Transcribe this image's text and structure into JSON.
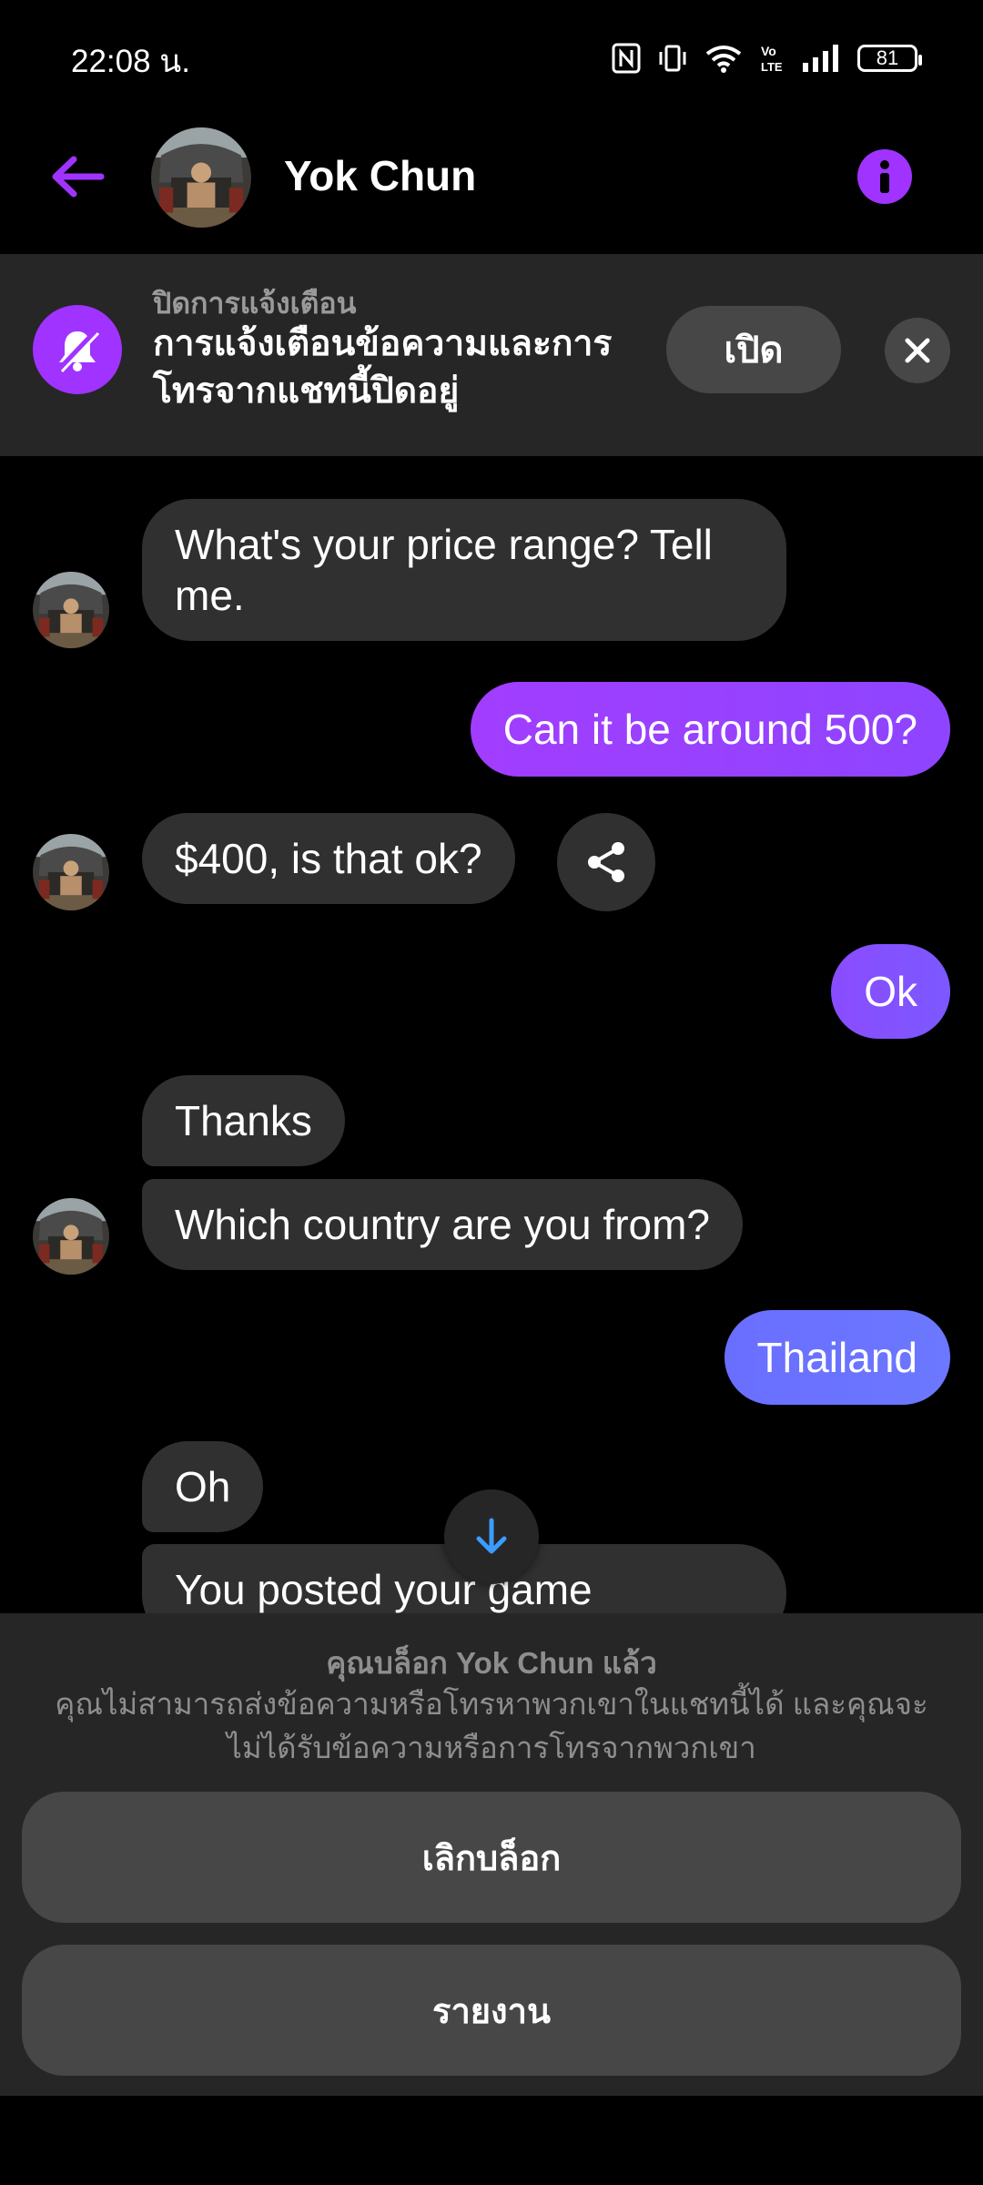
{
  "status_bar": {
    "time": "22:08 น.",
    "battery": "81",
    "icons": [
      "nfc-icon",
      "vibrate-icon",
      "wifi-icon",
      "volte-icon",
      "signal-icon",
      "battery-icon"
    ]
  },
  "header": {
    "contact_name": "Yok Chun",
    "back_icon": "arrow-left-icon",
    "info_icon": "info-icon"
  },
  "banner": {
    "title": "ปิดการแจ้งเตือน",
    "text": "การแจ้งเตือนข้อความและการโทรจากแชทนี้ปิดอยู่",
    "button_label": "เปิด",
    "icon": "bell-off-icon"
  },
  "messages": [
    {
      "from": "them",
      "text": "What's your price range? Tell me."
    },
    {
      "from": "me",
      "text": "Can it be around 500?"
    },
    {
      "from": "them",
      "text": "$400, is that ok?"
    },
    {
      "from": "me",
      "text": "Ok"
    },
    {
      "from": "them",
      "text": "Thanks"
    },
    {
      "from": "them",
      "text": "Which country are you from?"
    },
    {
      "from": "me",
      "text": "Thailand"
    },
    {
      "from": "them",
      "text": "Oh"
    },
    {
      "from": "them",
      "text": "You posted your game"
    }
  ],
  "blocked": {
    "title": "คุณบล็อก Yok Chun แล้ว",
    "description": "คุณไม่สามารถส่งข้อความหรือโทรหาพวกเขาในแชทนี้ได้ และคุณจะไม่ได้รับข้อความหรือการโทรจากพวกเขา",
    "unblock_label": "เลิกบล็อก",
    "report_label": "รายงาน"
  },
  "colors": {
    "accent": "#a033ff",
    "bubble_in": "#303030",
    "bubble_out_start": "#9b3cff",
    "bubble_out_end": "#6b78ff",
    "panel": "#262626",
    "panel_button": "#474747"
  }
}
